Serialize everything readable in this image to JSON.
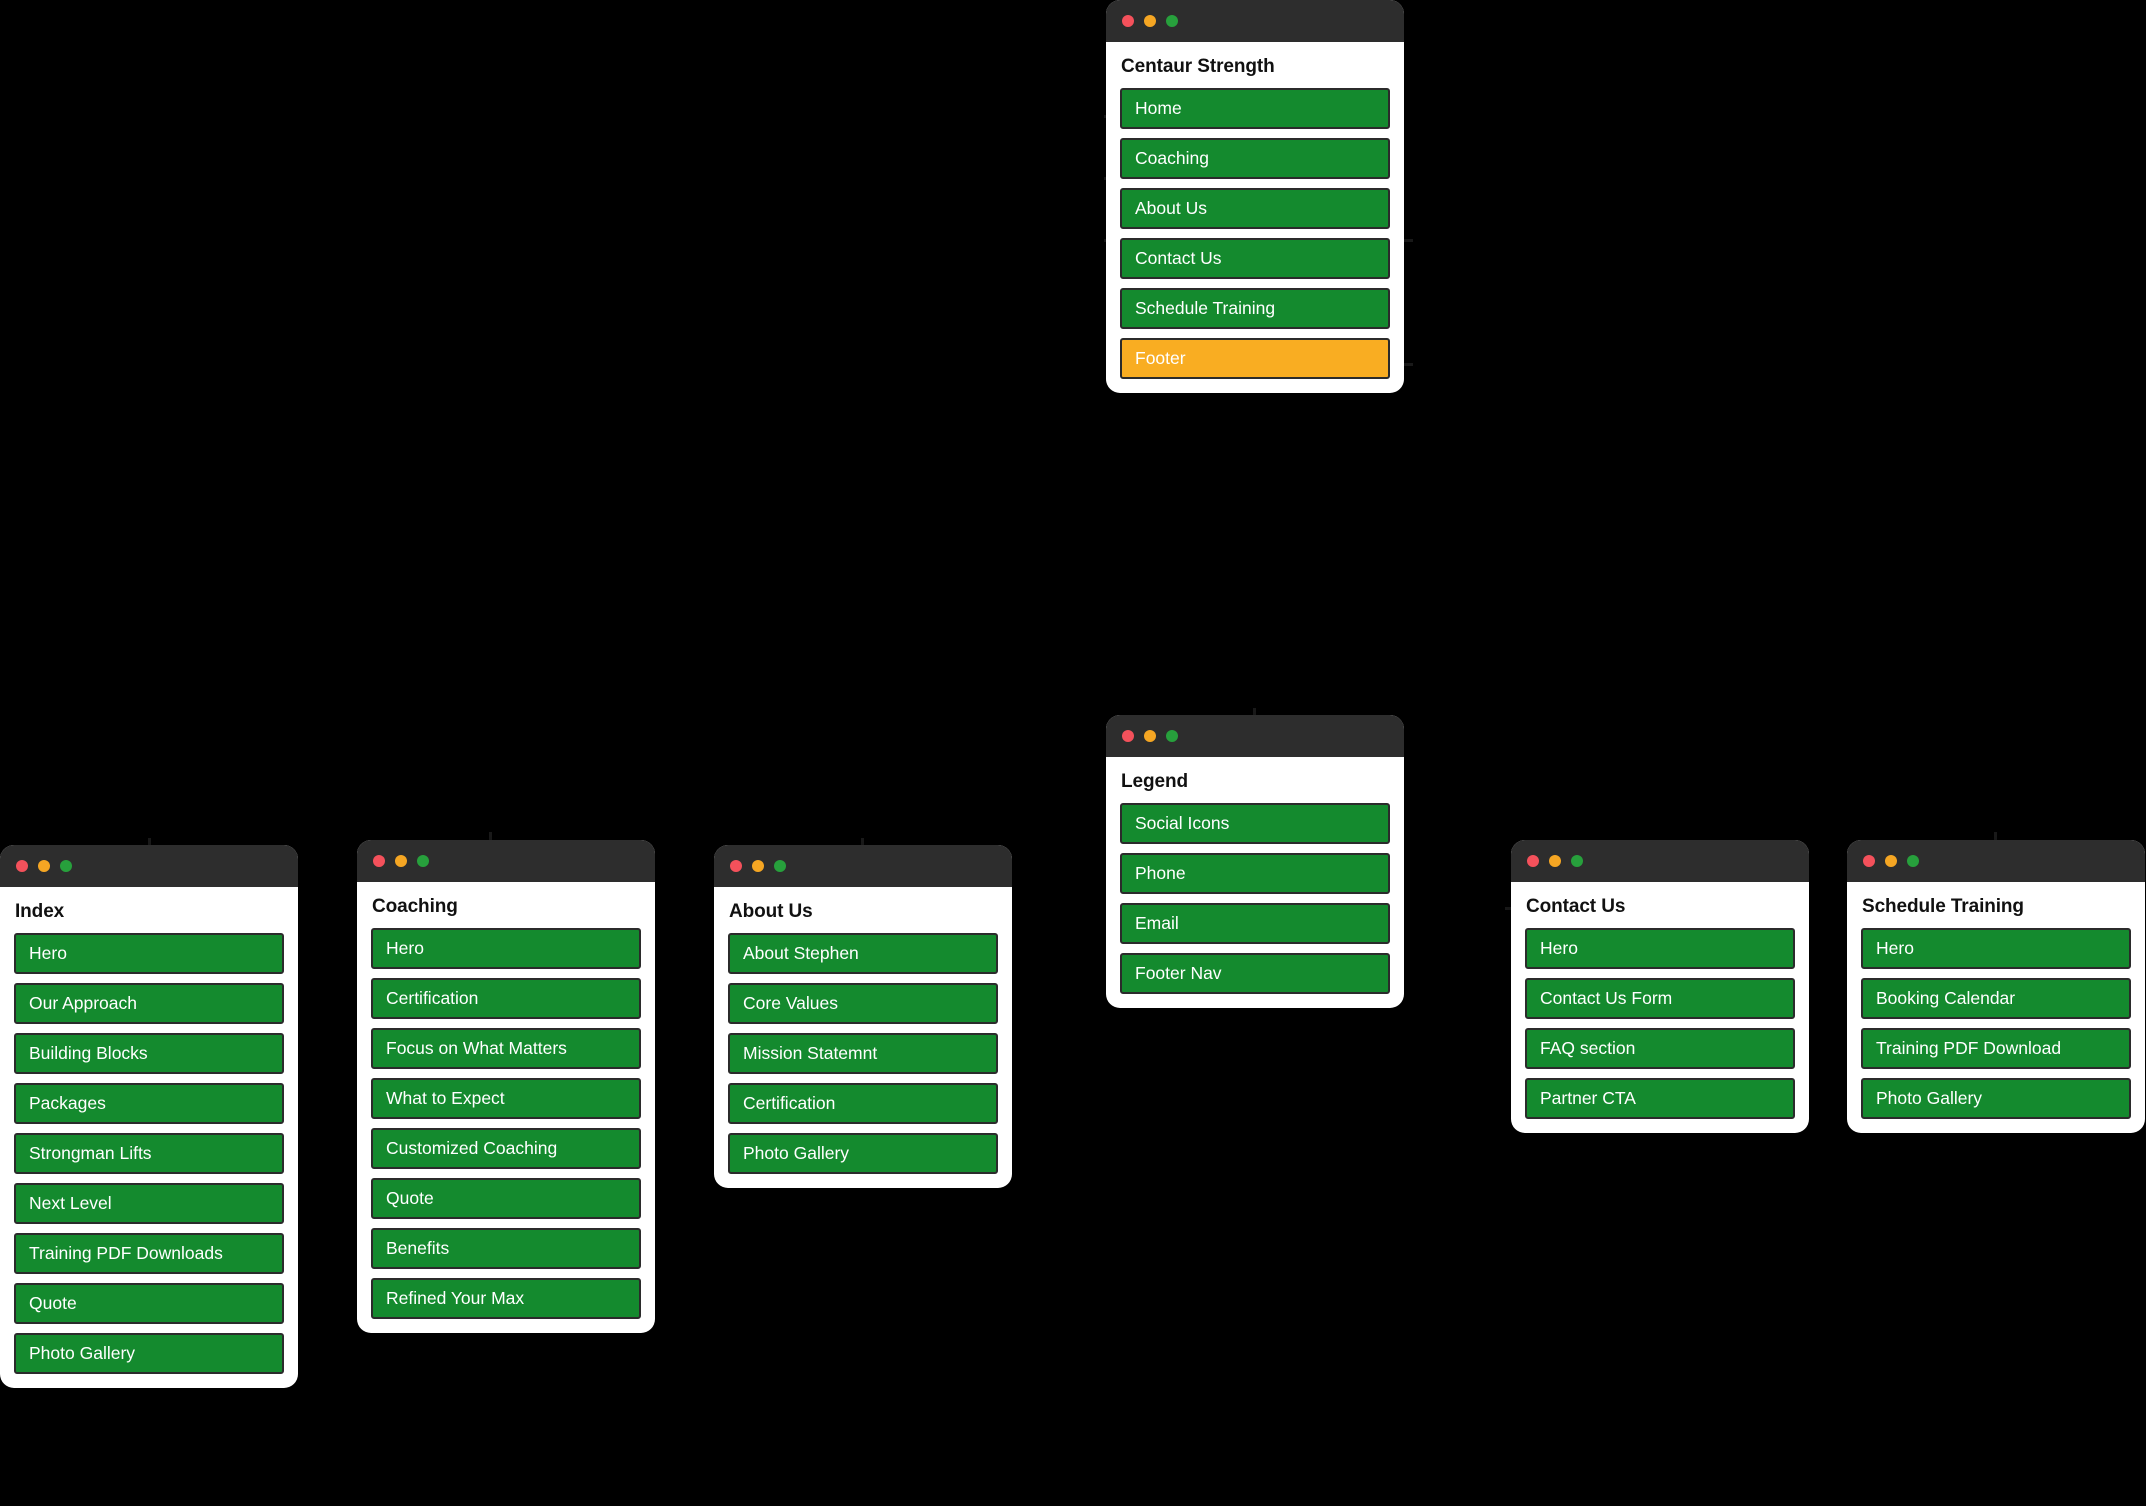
{
  "diagram": {
    "type": "sitemap",
    "background": "#000000",
    "node_color": "#148a2e",
    "accent_color": "#f9ad22",
    "titlebar_color": "#2d2d2d",
    "window_dots": [
      "close-dot",
      "minimize-dot",
      "maximize-dot"
    ]
  },
  "cards": {
    "main_nav": {
      "title": "Centaur Strength",
      "items": [
        {
          "label": "Home",
          "accent": false
        },
        {
          "label": "Coaching",
          "accent": false
        },
        {
          "label": "About Us",
          "accent": false
        },
        {
          "label": "Contact Us",
          "accent": false
        },
        {
          "label": "Schedule Training",
          "accent": false
        },
        {
          "label": "Footer",
          "accent": true
        }
      ]
    },
    "legend": {
      "title": "Legend",
      "items": [
        {
          "label": "Social Icons",
          "accent": false
        },
        {
          "label": "Phone",
          "accent": false
        },
        {
          "label": "Email",
          "accent": false
        },
        {
          "label": "Footer Nav",
          "accent": false
        }
      ]
    },
    "index": {
      "title": "Index",
      "items": [
        {
          "label": "Hero",
          "accent": false
        },
        {
          "label": "Our Approach",
          "accent": false
        },
        {
          "label": "Building Blocks",
          "accent": false
        },
        {
          "label": "Packages",
          "accent": false
        },
        {
          "label": "Strongman Lifts",
          "accent": false
        },
        {
          "label": "Next Level",
          "accent": false
        },
        {
          "label": "Training PDF Downloads",
          "accent": false
        },
        {
          "label": "Quote",
          "accent": false
        },
        {
          "label": "Photo Gallery",
          "accent": false
        }
      ]
    },
    "coaching": {
      "title": "Coaching",
      "items": [
        {
          "label": "Hero",
          "accent": false
        },
        {
          "label": "Certification",
          "accent": false
        },
        {
          "label": "Focus on What Matters",
          "accent": false
        },
        {
          "label": "What to Expect",
          "accent": false
        },
        {
          "label": "Customized Coaching",
          "accent": false
        },
        {
          "label": "Quote",
          "accent": false
        },
        {
          "label": "Benefits",
          "accent": false
        },
        {
          "label": "Refined Your Max",
          "accent": false
        }
      ]
    },
    "about_us": {
      "title": "About Us",
      "items": [
        {
          "label": "About Stephen",
          "accent": false
        },
        {
          "label": "Core Values",
          "accent": false
        },
        {
          "label": "Mission Statemnt",
          "accent": false
        },
        {
          "label": "Certification",
          "accent": false
        },
        {
          "label": "Photo Gallery",
          "accent": false
        }
      ]
    },
    "contact_us": {
      "title": "Contact Us",
      "items": [
        {
          "label": "Hero",
          "accent": false
        },
        {
          "label": "Contact Us Form",
          "accent": false
        },
        {
          "label": "FAQ section",
          "accent": false
        },
        {
          "label": "Partner CTA",
          "accent": false
        }
      ]
    },
    "schedule_training": {
      "title": "Schedule Training",
      "items": [
        {
          "label": "Hero",
          "accent": false
        },
        {
          "label": "Booking Calendar",
          "accent": false
        },
        {
          "label": "Training PDF Download",
          "accent": false
        },
        {
          "label": "Photo Gallery",
          "accent": false
        }
      ]
    }
  }
}
